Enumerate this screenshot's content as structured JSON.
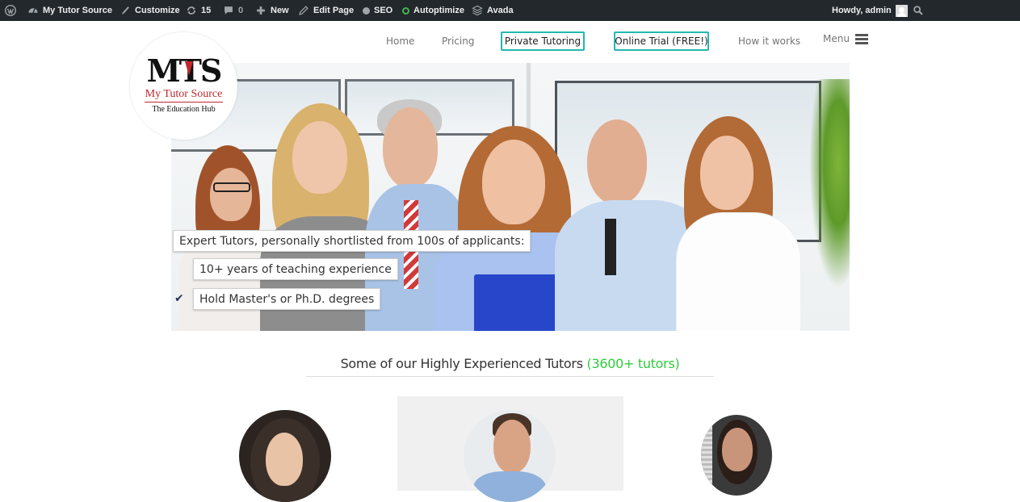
{
  "admin_bar": {
    "site_name": "My Tutor Source",
    "customize": "Customize",
    "updates_count": "15",
    "comments_count": "0",
    "new": "New",
    "edit_page": "Edit Page",
    "seo": "SEO",
    "autoptimize": "Autoptimize",
    "avada": "Avada",
    "greeting": "Howdy, admin"
  },
  "logo": {
    "monogram": "MTS",
    "name": "My Tutor Source",
    "tagline": "The Education Hub"
  },
  "nav": {
    "home": "Home",
    "pricing": "Pricing",
    "private_tutoring": "Private Tutoring",
    "online_trial": "Online Trial (FREE!)",
    "how_it_works": "How it works",
    "menu": "Menu"
  },
  "hero": {
    "headline": "Expert Tutors, personally shortlisted from 100s of applicants:",
    "bullets": [
      "10+ years of teaching experience",
      "Hold Master's or Ph.D. degrees"
    ]
  },
  "tutors": {
    "heading": "Some of our Highly Experienced Tutors",
    "count": "(3600+ tutors)"
  },
  "colors": {
    "admin_bar_bg": "#23282d",
    "accent_teal": "#21b8b0",
    "count_green": "#2fcb3c",
    "logo_red": "#c0272d"
  }
}
